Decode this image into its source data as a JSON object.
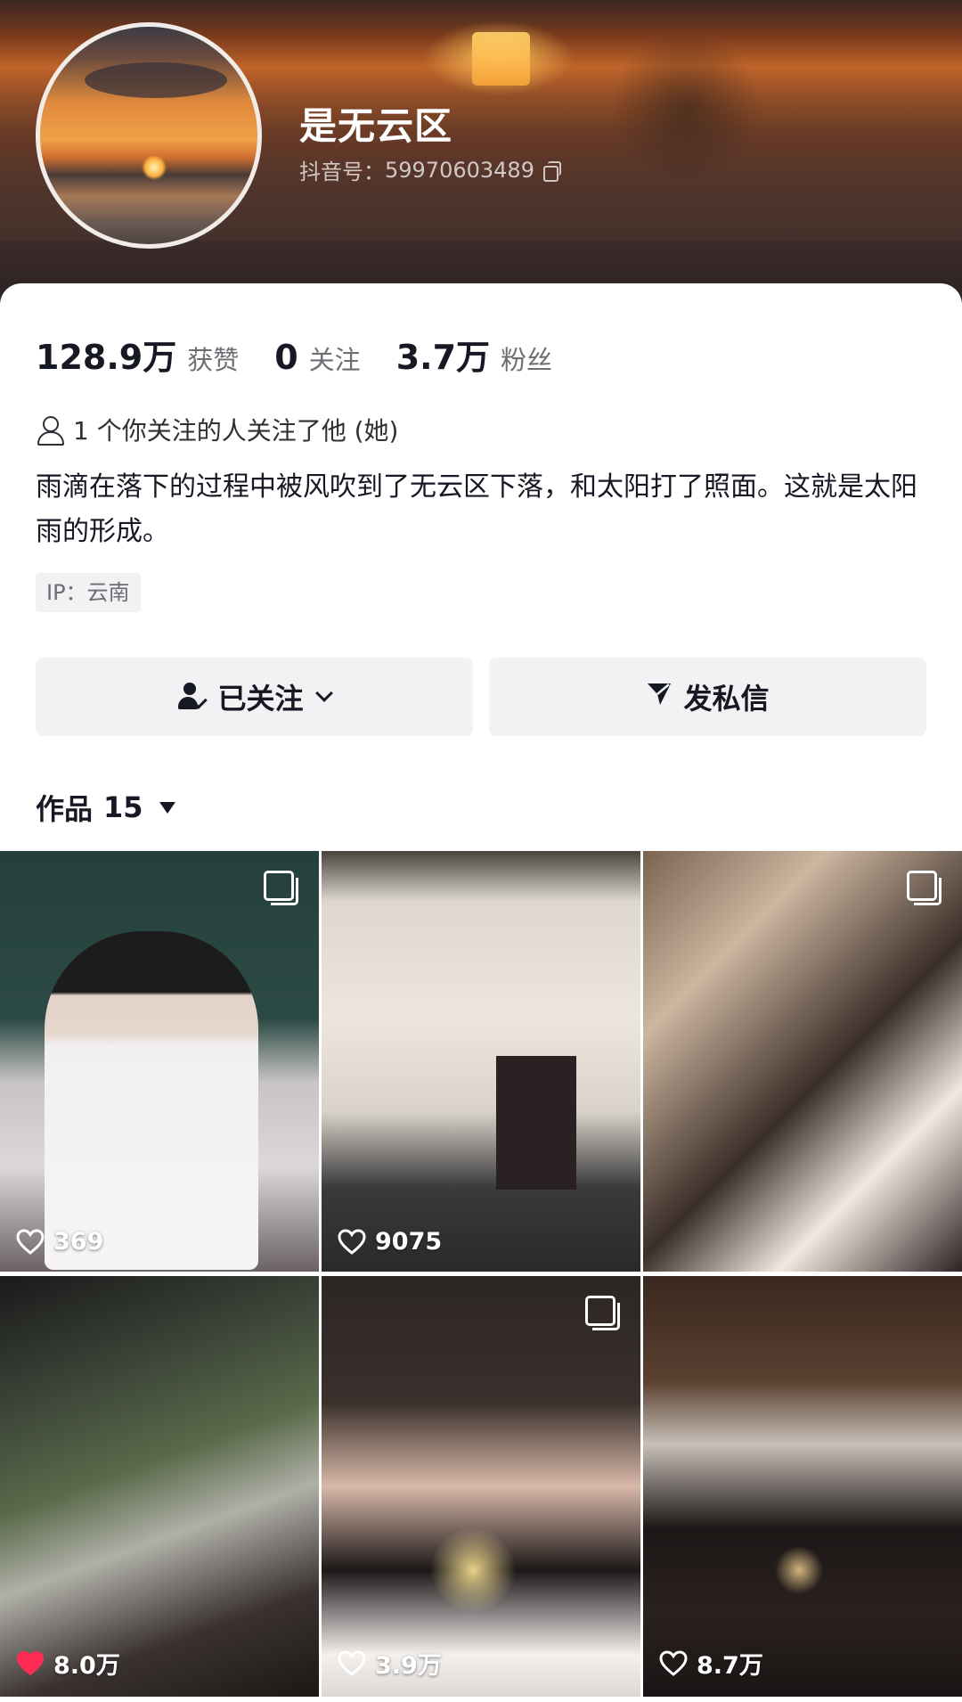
{
  "profile": {
    "nickname": "是无云区",
    "douyin_id_label": "抖音号：",
    "douyin_id": "59970603489"
  },
  "stats": [
    {
      "value": "128.9万",
      "label": "获赞"
    },
    {
      "value": "0",
      "label": "关注"
    },
    {
      "value": "3.7万",
      "label": "粉丝"
    }
  ],
  "mutual_text": "1 个你关注的人关注了他 (她)",
  "bio": "雨滴在落下的过程中被风吹到了无云区下落，和太阳打了照面。这就是太阳雨的形成。",
  "ip": "IP：云南",
  "buttons": {
    "followed": "已关注",
    "message": "发私信"
  },
  "works_tab": {
    "label": "作品",
    "count": "15"
  },
  "videos": [
    {
      "likes": "369",
      "multi_image": true,
      "liked": false
    },
    {
      "likes": "9075",
      "multi_image": false,
      "liked": false
    },
    {
      "likes": "",
      "multi_image": true,
      "liked": false
    },
    {
      "likes": "8.0万",
      "multi_image": false,
      "liked": true
    },
    {
      "likes": "3.9万",
      "multi_image": true,
      "liked": false
    },
    {
      "likes": "8.7万",
      "multi_image": false,
      "liked": false
    }
  ],
  "colors": {
    "liked_heart": "#fe2c55",
    "button_bg": "#f2f2f4",
    "secondary_text": "#6d6e74"
  }
}
